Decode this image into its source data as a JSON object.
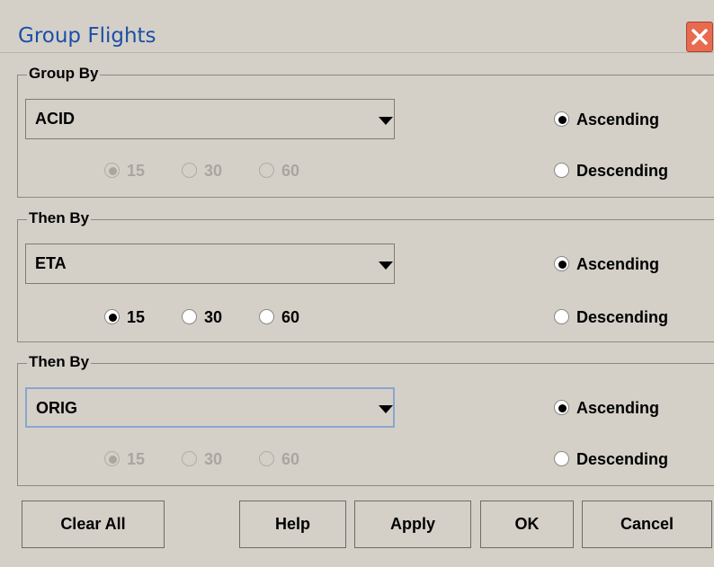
{
  "window": {
    "title": "Group Flights"
  },
  "groups": [
    {
      "label": "Group By",
      "field": "ACID",
      "interval_options": [
        "15",
        "30",
        "60"
      ],
      "interval_selected": "15",
      "interval_enabled": false,
      "sort_options": [
        "Ascending",
        "Descending"
      ],
      "sort_selected": "Ascending"
    },
    {
      "label": "Then By",
      "field": "ETA",
      "interval_options": [
        "15",
        "30",
        "60"
      ],
      "interval_selected": "15",
      "interval_enabled": true,
      "sort_options": [
        "Ascending",
        "Descending"
      ],
      "sort_selected": "Ascending"
    },
    {
      "label": "Then By",
      "field": "ORIG",
      "interval_options": [
        "15",
        "30",
        "60"
      ],
      "interval_selected": "15",
      "interval_enabled": false,
      "sort_options": [
        "Ascending",
        "Descending"
      ],
      "sort_selected": "Ascending"
    }
  ],
  "buttons": {
    "clear_all": "Clear All",
    "help": "Help",
    "apply": "Apply",
    "ok": "OK",
    "cancel": "Cancel"
  },
  "colors": {
    "title_text": "#1c4fa8",
    "dialog_bg": "#d4d0c8",
    "close_button": "#e86a4f"
  },
  "icons": {
    "close": "close-icon",
    "dropdown": "chevron-down-icon"
  }
}
